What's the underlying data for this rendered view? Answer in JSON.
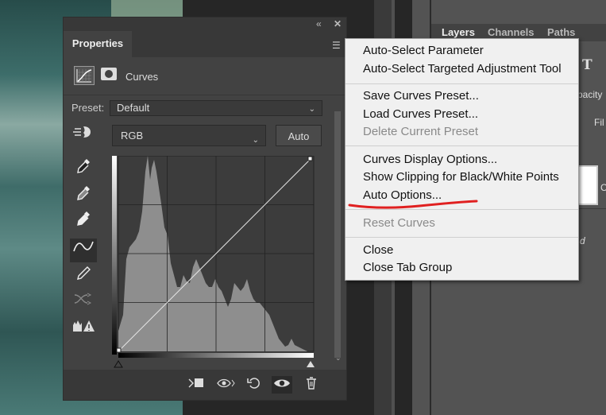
{
  "properties_panel": {
    "tab_label": "Properties",
    "collapse_icon": "double-chevron-icon",
    "close_icon": "close-icon",
    "menu_icon": "hamburger-menu-icon",
    "adjustment_name": "Curves",
    "preset_label": "Preset:",
    "preset_value": "Default",
    "channel_value": "RGB",
    "auto_label": "Auto",
    "tools": [
      "on-image-adjust-icon",
      "black-eyedropper-icon",
      "gray-eyedropper-icon",
      "white-eyedropper-icon",
      "curve-points-icon",
      "pencil-icon",
      "smooth-curve-icon",
      "clipping-warning-icon"
    ],
    "bottom_icons": [
      "clip-to-layer-icon",
      "view-previous-icon",
      "reset-icon",
      "visibility-eye-icon",
      "trash-icon"
    ]
  },
  "layers_panel": {
    "tabs": [
      "Layers",
      "Channels",
      "Paths"
    ],
    "partial_opacity": "pacity",
    "partial_fill": "Fil",
    "partial_c": "C",
    "partial_d": "d"
  },
  "context_menu": {
    "group1": [
      "Auto-Select Parameter",
      "Auto-Select Targeted Adjustment Tool"
    ],
    "group2": [
      {
        "label": "Save Curves Preset...",
        "enabled": true
      },
      {
        "label": "Load Curves Preset...",
        "enabled": true
      },
      {
        "label": "Delete Current Preset",
        "enabled": false
      }
    ],
    "group3": [
      "Curves Display Options...",
      "Show Clipping for Black/White Points",
      "Auto Options..."
    ],
    "group4": [
      {
        "label": "Reset Curves",
        "enabled": false
      }
    ],
    "group5": [
      "Close",
      "Close Tab Group"
    ]
  },
  "colors": {
    "annotation": "#e02020",
    "menu_bg": "#f0f0f0",
    "panel_bg": "#424242"
  }
}
